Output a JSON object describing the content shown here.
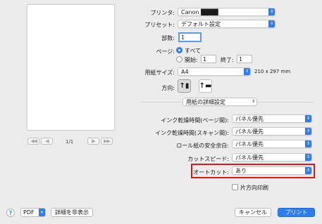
{
  "preview": {
    "page_indicator": "1/1"
  },
  "nav": {
    "first": "◀◀",
    "prev": "◀",
    "next": "▶",
    "last": "▶▶"
  },
  "printer": {
    "label": "プリンタ:",
    "value": "Canon ████"
  },
  "preset": {
    "label": "プリセット:",
    "value": "デフォルト設定"
  },
  "copies": {
    "label": "部数:",
    "value": "1"
  },
  "pages": {
    "label": "ページ:",
    "all_label": "すべて",
    "from_label": "開始:",
    "from_value": "1",
    "to_label": "終了:",
    "to_value": "1"
  },
  "paper_size": {
    "label": "用紙サイズ:",
    "value": "A4",
    "dims": "210 x 297 mm"
  },
  "orientation": {
    "label": "方向:",
    "portrait_glyph": "↑▮",
    "landscape_glyph": "↑▬"
  },
  "section": {
    "value": "用紙の詳細設定"
  },
  "settings": [
    {
      "label": "インク乾燥時間(ページ間):",
      "value": "パネル優先"
    },
    {
      "label": "インク乾燥時間(スキャン間):",
      "value": "パネル優先"
    },
    {
      "label": "ロール紙の安全余白:",
      "value": "パネル優先"
    },
    {
      "label": "カットスピード:",
      "value": "パネル優先"
    },
    {
      "label": "オートカット:",
      "value": "あり"
    }
  ],
  "one_side": {
    "label": "片方向印刷"
  },
  "bottom": {
    "help": "?",
    "pdf": "PDF",
    "hide_details": "詳細を非表示",
    "cancel": "キャンセル",
    "print": "プリント"
  },
  "colors": {
    "accent": "#2e7cf6",
    "highlight": "#e0161b"
  }
}
